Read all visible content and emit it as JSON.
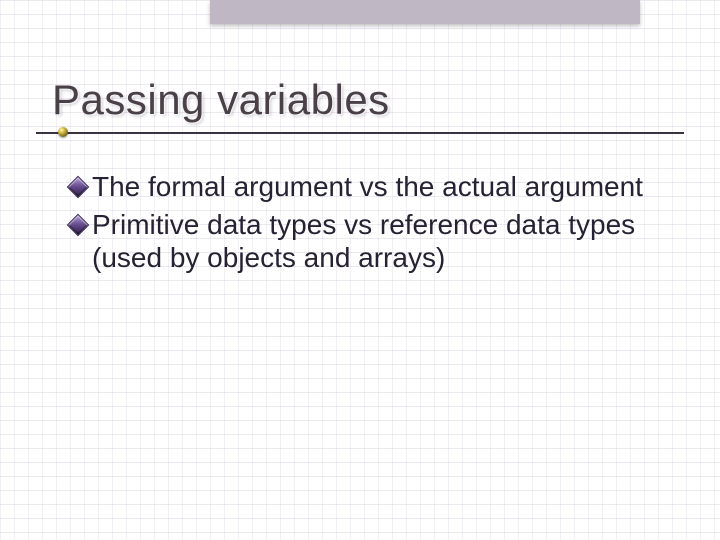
{
  "title": "Passing variables",
  "bullets": [
    {
      "text": "The formal argument vs the actual argument"
    },
    {
      "text": "Primitive data types vs reference data types (used by objects and arrays)"
    }
  ]
}
